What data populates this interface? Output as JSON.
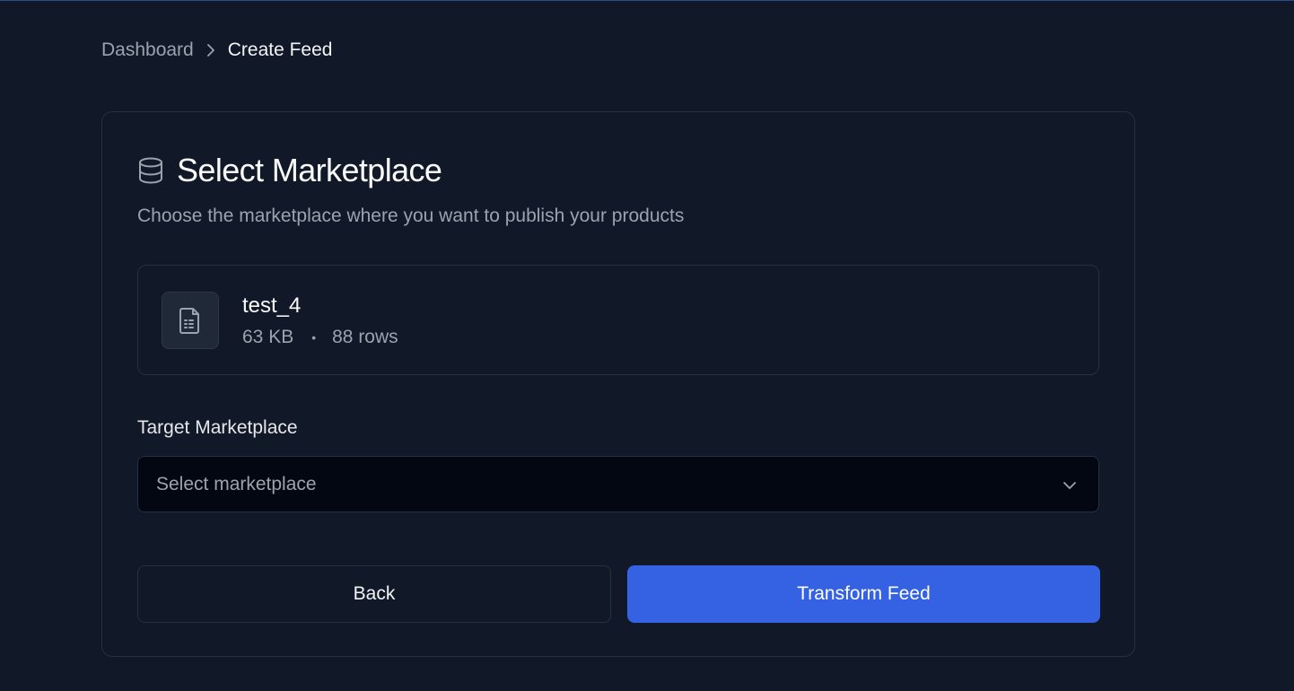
{
  "breadcrumb": {
    "items": [
      "Dashboard",
      "Create Feed"
    ],
    "separator_icon": "chevron-right-icon"
  },
  "card": {
    "title": "Select Marketplace",
    "title_icon": "database-icon",
    "subtitle": "Choose the marketplace where you want to publish your products"
  },
  "file": {
    "icon": "file-spreadsheet-icon",
    "name": "test_4",
    "size": "63 KB",
    "separator": "•",
    "rows": "88 rows"
  },
  "marketplace": {
    "label": "Target Marketplace",
    "placeholder": "Select marketplace",
    "dropdown_icon": "chevron-down-icon"
  },
  "actions": {
    "back_label": "Back",
    "primary_label": "Transform Feed"
  },
  "colors": {
    "background": "#111827",
    "primary": "#3562e3",
    "border": "#253042"
  }
}
